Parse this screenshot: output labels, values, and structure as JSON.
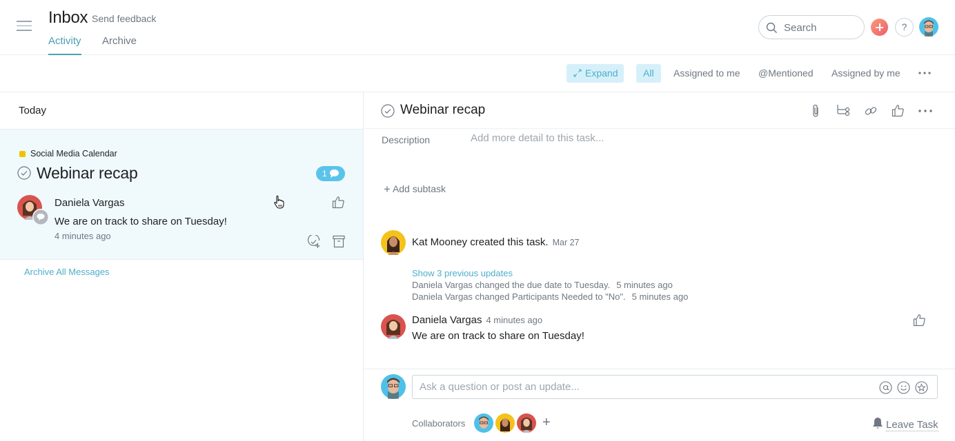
{
  "header": {
    "title": "Inbox",
    "feedback_label": "Send feedback",
    "tabs": [
      {
        "label": "Activity",
        "active": true
      },
      {
        "label": "Archive",
        "active": false
      }
    ],
    "search_placeholder": "Search",
    "help_label": "?"
  },
  "filterbar": {
    "expand_label": "Expand",
    "filters": [
      {
        "label": "All",
        "active": true
      },
      {
        "label": "Assigned to me",
        "active": false
      },
      {
        "label": "@Mentioned",
        "active": false
      },
      {
        "label": "Assigned by me",
        "active": false
      }
    ]
  },
  "inbox": {
    "section_label": "Today",
    "card": {
      "project": "Social Media Calendar",
      "project_color": "#eec300",
      "task_title": "Webinar recap",
      "comment_count": "1",
      "author": "Daniela Vargas",
      "message": "We are on track to share on Tuesday!",
      "time": "4 minutes ago"
    },
    "archive_all_label": "Archive All Messages"
  },
  "task": {
    "title": "Webinar recap",
    "description_label": "Description",
    "description_placeholder": "Add more detail to this task...",
    "add_subtask_label": "Add subtask",
    "created_story": {
      "text": "Kat Mooney created this task.",
      "date": "Mar 27"
    },
    "show_previous_label": "Show 3 previous updates",
    "mini_stories": [
      {
        "who": "Daniela Vargas",
        "action": "changed the due date to Tuesday.",
        "time": "5 minutes ago"
      },
      {
        "who": "Daniela Vargas",
        "action": "changed Participants Needed to \"No\".",
        "time": "5 minutes ago"
      }
    ],
    "comment": {
      "author": "Daniela Vargas",
      "time": "4 minutes ago",
      "text": "We are on track to share on Tuesday!"
    },
    "composer_placeholder": "Ask a question or post an update...",
    "collaborators_label": "Collaborators",
    "leave_label": "Leave Task"
  },
  "colors": {
    "accent": "#4eaecb",
    "badge": "#5bc3ea",
    "selected_card_bg": "#f0fafd",
    "filter_active_bg": "#d6f0fa"
  }
}
